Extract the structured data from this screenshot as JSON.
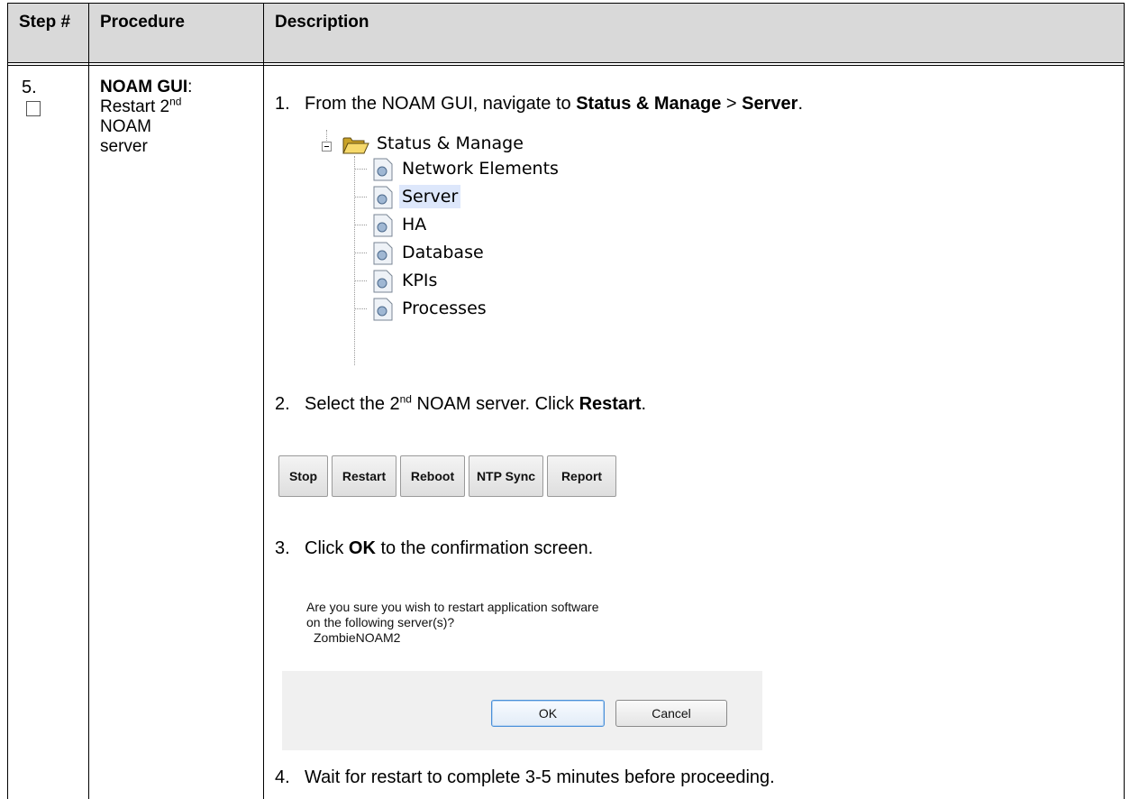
{
  "table": {
    "headers": {
      "step": "Step #",
      "procedure": "Procedure",
      "description": "Description"
    },
    "row": {
      "step_number": "5.",
      "procedure_bold": "NOAM GUI",
      "procedure_colon": ":",
      "procedure_line1": "Restart 2",
      "procedure_sup": "nd",
      "procedure_line2": "NOAM",
      "procedure_line3": "server"
    }
  },
  "steps": [
    {
      "num": "1.",
      "pre": "From the NOAM GUI, navigate to ",
      "bold1": "Status & Manage",
      "mid": " > ",
      "bold2": "Server",
      "post": "."
    },
    {
      "num": "2.",
      "pre": "Select the 2",
      "sup": "nd",
      "mid": " NOAM server.  Click ",
      "bold": "Restart",
      "post": "."
    },
    {
      "num": "3.",
      "pre": "Click ",
      "bold": "OK",
      "post": " to the confirmation screen."
    },
    {
      "num": "4.",
      "text": "Wait for restart to complete 3-5 minutes before proceeding."
    }
  ],
  "tree": {
    "folder": "Status & Manage",
    "items": [
      "Network Elements",
      "Server",
      "HA",
      "Database",
      "KPIs",
      "Processes"
    ],
    "selected": "Server"
  },
  "toolbar": {
    "buttons": [
      "Stop",
      "Restart",
      "Reboot",
      "NTP Sync",
      "Report"
    ]
  },
  "confirm": {
    "line1": "Are you sure you wish to restart application software",
    "line2": "on the following server(s)?",
    "server": "ZombieNOAM2",
    "ok": "OK",
    "cancel": "Cancel"
  },
  "colors": {
    "header_bg": "#d9d9d9",
    "selected_bg": "#dde7fb",
    "dialog_bg": "#f0f0f0",
    "ok_border": "#4a90d9"
  }
}
